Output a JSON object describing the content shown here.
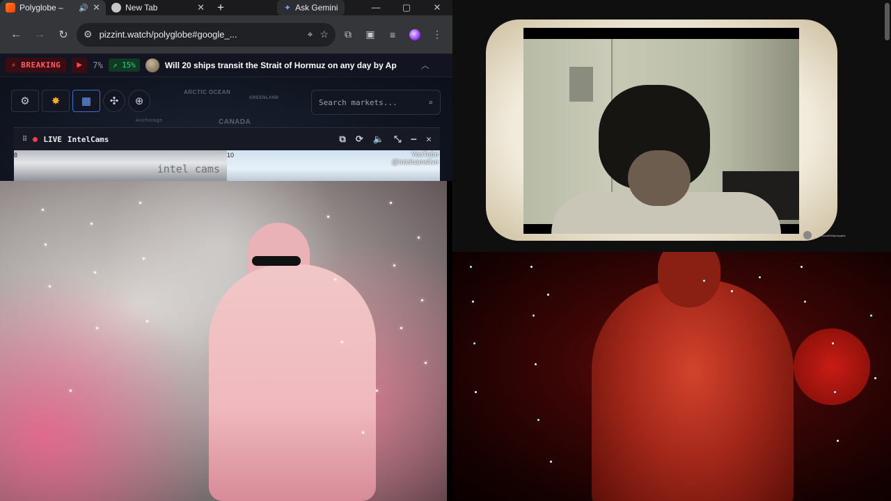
{
  "browser": {
    "tabs": [
      {
        "title": "Polyglobe –",
        "active": true,
        "has_audio": true
      },
      {
        "title": "New Tab",
        "active": false,
        "has_audio": false
      }
    ],
    "new_tab_symbol": "+",
    "gemini_label": "Ask Gemini",
    "url": "pizzint.watch/polyglobe#google_...",
    "window_controls": {
      "minimize": "—",
      "maximize": "▢",
      "close": "✕"
    }
  },
  "ticker": {
    "breaking_label": "BREAKING",
    "percent": "7%",
    "change": "15%",
    "headline": "Will 20 ships transit the Strait of Hormuz on any day by Ap"
  },
  "map": {
    "labels": [
      "ARCTIC OCEAN",
      "GREENLAND",
      "CANADA",
      "Anchorage"
    ],
    "search_placeholder": "Search markets...",
    "buttons": [
      "gear-icon",
      "burst-icon",
      "calendar-icon",
      "wind-icon",
      "crosshair-icon"
    ]
  },
  "cam_panel": {
    "live_label": "LIVE",
    "title": "IntelCams",
    "feed1_number": "8",
    "feed1_watermark": "intel cams",
    "feed2_number": "10",
    "feed2_watermark_line1": "YouTube",
    "feed2_watermark_line2": "@intelcamslive"
  },
  "webcams": {
    "top_right_channel": "OMGSoundOfApocrypha"
  },
  "colors": {
    "breaking_red": "#ff5b64",
    "positive_green": "#2fd27a",
    "accent_blue": "#3a6bd8"
  }
}
